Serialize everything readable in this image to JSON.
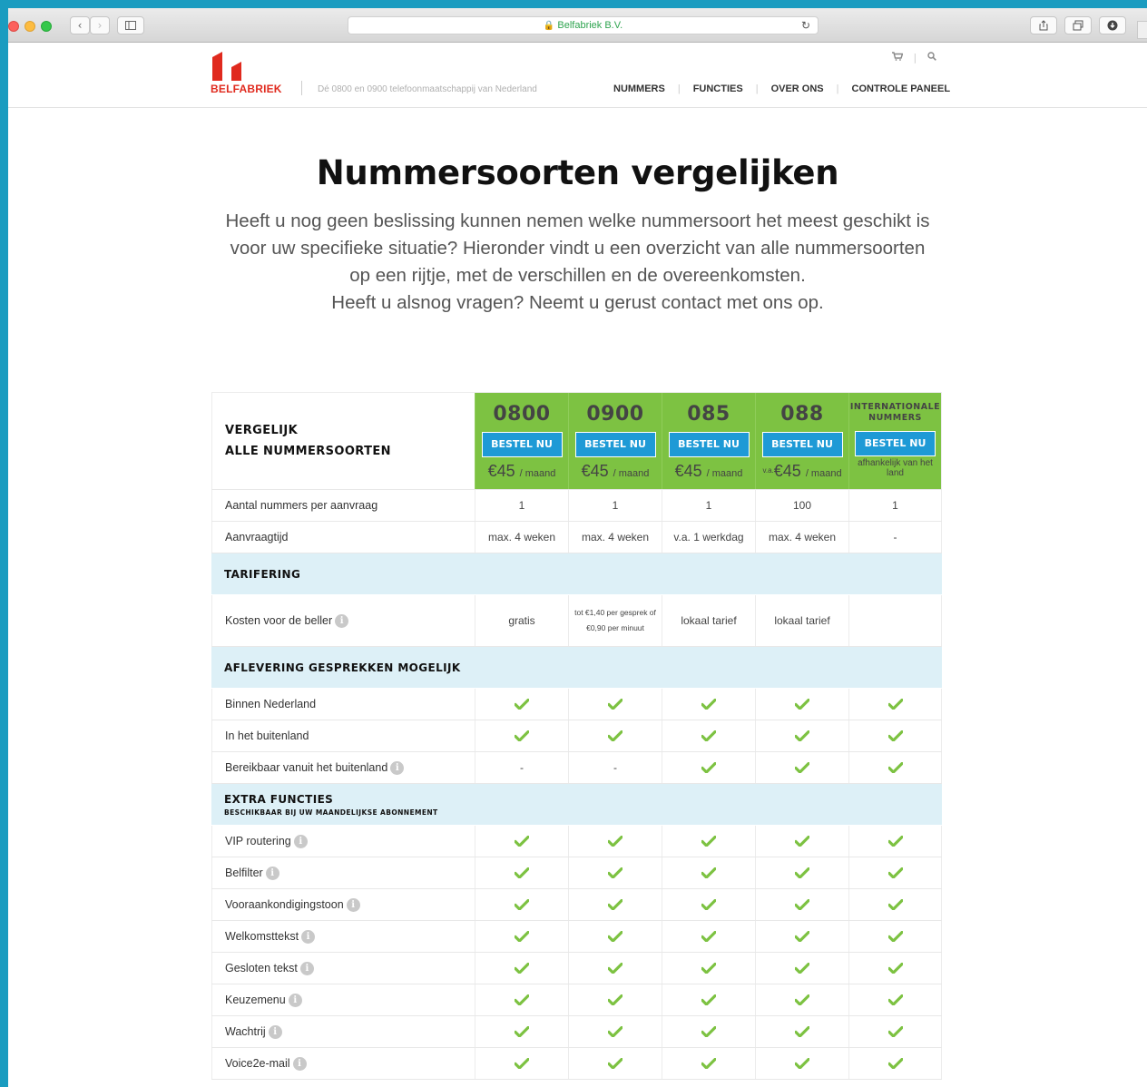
{
  "browser": {
    "url": "Belfabriek B.V."
  },
  "header": {
    "logo": "BELFABRIEK",
    "tagline": "Dé 0800 en 0900 telefoonmaatschappij van Nederland",
    "nav": [
      "NUMMERS",
      "FUNCTIES",
      "OVER ONS",
      "CONTROLE PANEEL"
    ]
  },
  "hero": {
    "title": "Nummersoorten vergelijken",
    "intro_lines": [
      "Heeft u nog geen beslissing kunnen nemen welke nummersoort het meest geschikt is",
      "voor uw specifieke situatie? Hieronder vindt u een overzicht van alle nummersoorten",
      "op een rijtje, met de verschillen en de overeenkomsten.",
      "Heeft u alsnog vragen? Neemt u gerust contact met ons op."
    ]
  },
  "table": {
    "heading_line1": "VERGELIJK",
    "heading_line2": "ALLE NUMMERSOORTEN",
    "order_label": "BESTEL NU",
    "plans": [
      {
        "name": "0800",
        "price": "€45",
        "per": "/ maand",
        "prefix": ""
      },
      {
        "name": "0900",
        "price": "€45",
        "per": "/ maand",
        "prefix": ""
      },
      {
        "name": "085",
        "price": "€45",
        "per": "/ maand",
        "prefix": ""
      },
      {
        "name": "088",
        "price": "€45",
        "per": "/ maand",
        "prefix": "v.a."
      },
      {
        "name": "INTERNATIONALE NUMMERS",
        "note": "afhankelijk van het land"
      }
    ],
    "rows": [
      {
        "label": "Aantal nummers per aanvraag",
        "values": [
          "1",
          "1",
          "1",
          "100",
          "1"
        ]
      },
      {
        "label": "Aanvraagtijd",
        "values": [
          "max. 4 weken",
          "max. 4 weken",
          "v.a. 1 werkdag",
          "max. 4 weken",
          "-"
        ]
      }
    ],
    "tarifering": {
      "title": "TARIFERING",
      "label": "Kosten voor de beller",
      "values": [
        "gratis",
        "tot €1,40 per gesprek of €0,90 per minuut",
        "lokaal tarief",
        "lokaal tarief",
        ""
      ]
    },
    "aflevering": {
      "title": "AFLEVERING GESPREKKEN MOGELIJK",
      "rows": [
        {
          "label": "Binnen Nederland",
          "info": false,
          "values": [
            "check",
            "check",
            "check",
            "check",
            "check"
          ]
        },
        {
          "label": "In het buitenland",
          "info": false,
          "values": [
            "check",
            "check",
            "check",
            "check",
            "check"
          ]
        },
        {
          "label": "Bereikbaar vanuit het buitenland",
          "info": true,
          "values": [
            "-",
            "-",
            "check",
            "check",
            "check"
          ]
        }
      ]
    },
    "extra": {
      "title": "EXTRA FUNCTIES",
      "subtitle": "BESCHIKBAAR BIJ UW MAANDELIJKSE ABONNEMENT",
      "rows": [
        {
          "label": "VIP routering"
        },
        {
          "label": "Belfilter"
        },
        {
          "label": "Vooraankondigingstoon"
        },
        {
          "label": "Welkomsttekst"
        },
        {
          "label": "Gesloten tekst"
        },
        {
          "label": "Keuzemenu"
        },
        {
          "label": "Wachtrij"
        },
        {
          "label": "Voice2e-mail"
        }
      ]
    }
  },
  "colors": {
    "plan_green": "#7dc242",
    "button_blue": "#1e9ad6",
    "section_bg": "#ddf0f7",
    "check_green": "#7dc242",
    "logo_red": "#e02a1e"
  }
}
